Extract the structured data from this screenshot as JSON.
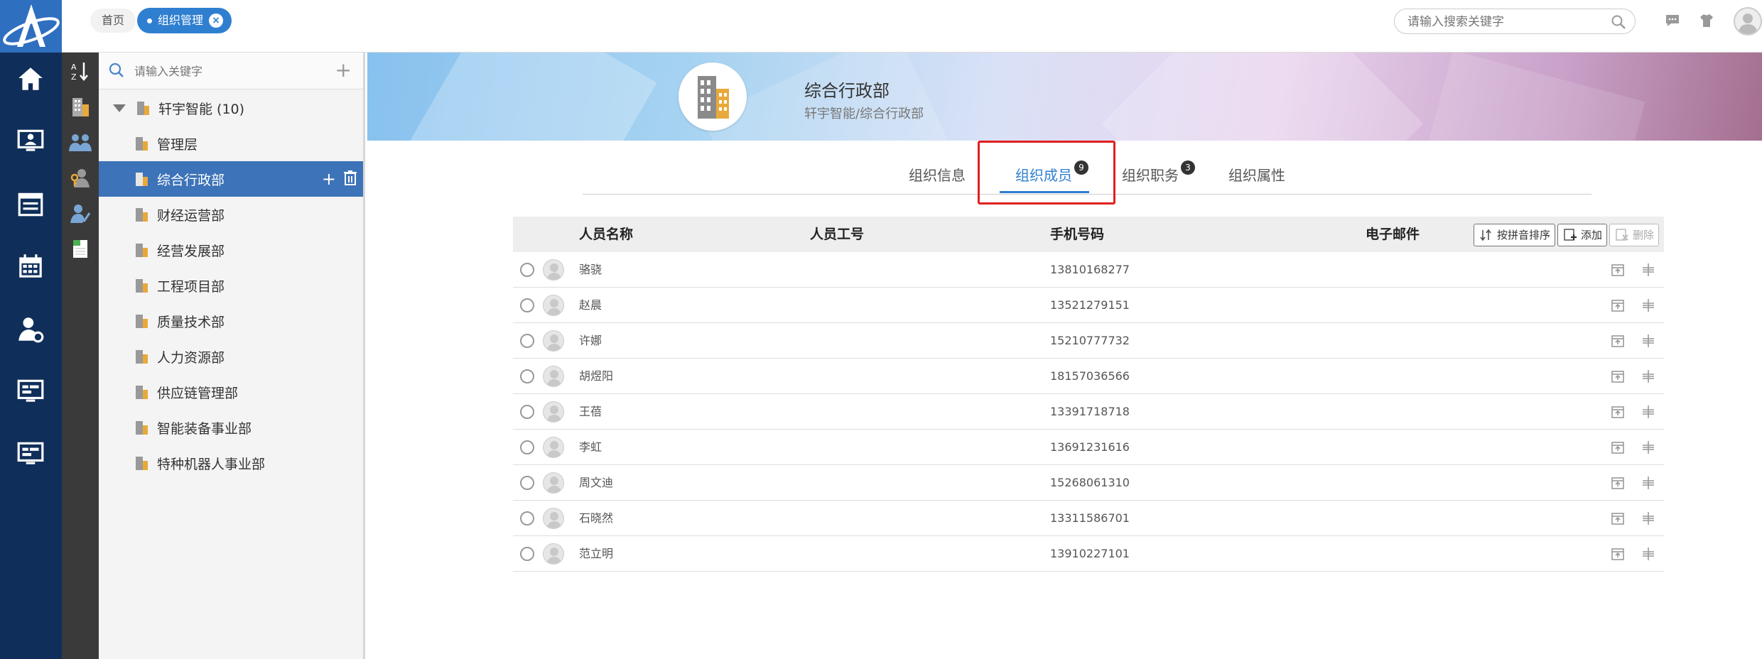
{
  "topbar": {
    "home_tab": "首页",
    "active_tab": "组织管理",
    "search_placeholder": "请输入搜索关键字"
  },
  "tree": {
    "search_placeholder": "请输入关键字",
    "root": "轩宇智能 (10)",
    "items": [
      "管理层",
      "综合行政部",
      "财经运营部",
      "经营发展部",
      "工程项目部",
      "质量技术部",
      "人力资源部",
      "供应链管理部",
      "智能装备事业部",
      "特种机器人事业部"
    ],
    "selected_index": 1
  },
  "banner": {
    "title": "综合行政部",
    "path": "轩宇智能/综合行政部"
  },
  "tabs": {
    "items": [
      "组织信息",
      "组织成员",
      "组织职务",
      "组织属性"
    ],
    "active": "组织成员",
    "members_badge": "9",
    "duties_badge": "3"
  },
  "table": {
    "headers": [
      "人员名称",
      "人员工号",
      "手机号码",
      "电子邮件"
    ],
    "btn_sort": "按拼音排序",
    "btn_add": "添加",
    "btn_delete": "删除",
    "rows": [
      {
        "name": "骆骁",
        "id": "",
        "phone": "13810168277",
        "email": ""
      },
      {
        "name": "赵晨",
        "id": "",
        "phone": "13521279151",
        "email": ""
      },
      {
        "name": "许娜",
        "id": "",
        "phone": "15210777732",
        "email": ""
      },
      {
        "name": "胡煜阳",
        "id": "",
        "phone": "18157036566",
        "email": ""
      },
      {
        "name": "王蓓",
        "id": "",
        "phone": "13391718718",
        "email": ""
      },
      {
        "name": "李虹",
        "id": "",
        "phone": "13691231616",
        "email": ""
      },
      {
        "name": "周文迪",
        "id": "",
        "phone": "15268061310",
        "email": ""
      },
      {
        "name": "石晓然",
        "id": "",
        "phone": "13311586701",
        "email": ""
      },
      {
        "name": "范立明",
        "id": "",
        "phone": "13910227101",
        "email": ""
      }
    ]
  },
  "colors": {
    "rail": "#0f2f5a",
    "accent": "#2f7fd0",
    "selected": "#3d73b8",
    "highlight": "#e02020"
  }
}
